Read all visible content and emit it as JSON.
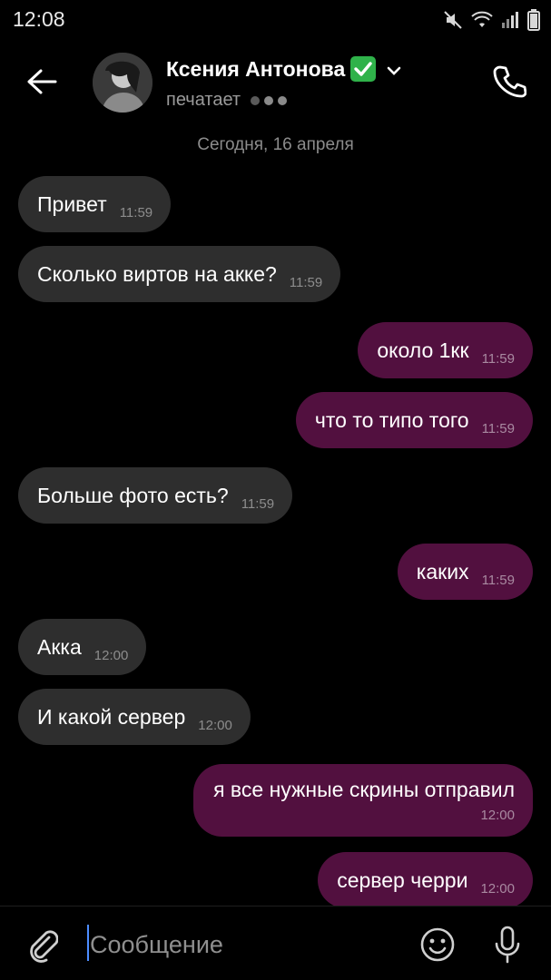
{
  "status_bar": {
    "time": "12:08",
    "icons": [
      "mute-icon",
      "wifi-icon",
      "signal-icon",
      "battery-icon"
    ]
  },
  "header": {
    "contact_name": "Ксения Антонова",
    "verified_icon": "check-box-icon",
    "status_text": "печатает",
    "back_icon": "arrow-left-icon",
    "call_icon": "phone-icon"
  },
  "chat": {
    "date_separator": "Сегодня, 16 апреля",
    "messages": [
      {
        "direction": "in",
        "text": "Привет",
        "time": "11:59"
      },
      {
        "direction": "in",
        "text": "Сколько виртов на акке?",
        "time": "11:59"
      },
      {
        "direction": "out",
        "text": "около 1кк",
        "time": "11:59"
      },
      {
        "direction": "out",
        "text": "что то типо того",
        "time": "11:59"
      },
      {
        "direction": "in",
        "text": "Больше фото есть?",
        "time": "11:59"
      },
      {
        "direction": "out",
        "text": "каких",
        "time": "11:59"
      },
      {
        "direction": "in",
        "text": "Акка",
        "time": "12:00"
      },
      {
        "direction": "in",
        "text": "И какой сервер",
        "time": "12:00"
      },
      {
        "direction": "out",
        "text": "я все нужные скрины отправил",
        "time": "12:00"
      },
      {
        "direction": "out",
        "text": "сервер черри",
        "time": "12:00"
      }
    ]
  },
  "input_bar": {
    "placeholder": "Сообщение",
    "value": "",
    "icons": [
      "paperclip-icon",
      "emoji-icon",
      "microphone-icon"
    ]
  },
  "colors": {
    "background": "#000000",
    "incoming_bubble": "#2e2e2e",
    "outgoing_bubble": "#52103f",
    "verified": "#2fb24a",
    "caret": "#4d8dff"
  }
}
